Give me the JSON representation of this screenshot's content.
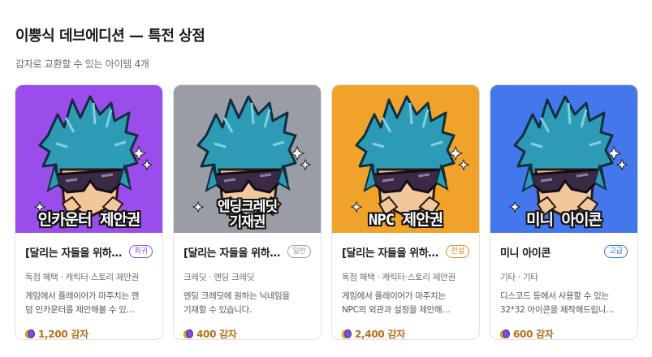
{
  "header": {
    "title": "이뿡식 데브에디션 — 특전 상점",
    "subtitle": "감자로 교환할 수 있는 아이템 4개"
  },
  "icons": {
    "currency": "potato-coin-icon",
    "sparkle": "sparkle-icon"
  },
  "cards": [
    {
      "banner": "인카운터 제안권",
      "banner_bg": "#9b4dec",
      "name": "[달리는 자들을 위하…",
      "rarity": "희귀",
      "rarity_color": "#8a4de0",
      "category": "독점 혜택 · 캐릭터·스토리 제안권",
      "desc_line1": "게임에서 플레이어가 마주치는 랜",
      "desc_line2": "덤 인카운터를 제안해볼 수 있…",
      "price": "1,200 감자"
    },
    {
      "banner_line1": "엔딩크레딧",
      "banner_line2": "기재권",
      "banner_bg": "#9a9ca6",
      "name": "[달리는 자들을 위하…",
      "rarity": "일반",
      "rarity_color": "#9a9a9a",
      "category": "크레딧 · 엔딩 크레딧",
      "desc_line1": "엔딩 크레딧에 원하는 닉네임을",
      "desc_line2": "기재할 수 있습니다.",
      "price": "400 감자"
    },
    {
      "banner": "NPC 제안권",
      "banner_bg": "#f0a22b",
      "name": "[달리는 자들을 위하…",
      "rarity": "전설",
      "rarity_color": "#e08a1a",
      "category": "독점 혜택 · 캐릭터·스토리 제안권",
      "desc_line1": "게임에서 플레이어가 마주치는",
      "desc_line2": "NPC의 외관과 설정을 제안해…",
      "price": "2,400 감자"
    },
    {
      "banner": "미니 아이콘",
      "banner_bg": "#4477ec",
      "name": "미니 아이콘",
      "rarity": "고급",
      "rarity_color": "#3a6fd8",
      "category": "기타 · 기타",
      "desc_line1": "디스코드 등에서 사용할 수 있는",
      "desc_line2": "32*32 아이콘을 제작해드립니…",
      "price": "600 감자"
    }
  ]
}
